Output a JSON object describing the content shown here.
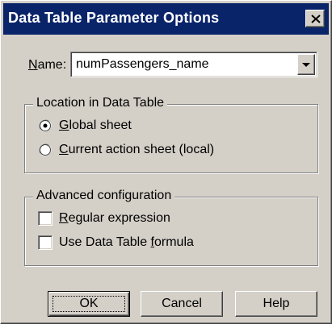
{
  "window": {
    "title": "Data Table Parameter Options"
  },
  "name_field": {
    "label_mnemonic": "N",
    "label_rest": "ame:",
    "value": "numPassengers_name"
  },
  "location_group": {
    "title": "Location in Data Table",
    "options": [
      {
        "mnemonic": "G",
        "rest": "lobal sheet",
        "selected": true
      },
      {
        "mnemonic": "C",
        "rest": "urrent action sheet (local)",
        "selected": false
      }
    ]
  },
  "advanced_group": {
    "title": "Advanced configuration",
    "options": [
      {
        "mnemonic": "R",
        "rest": "egular expression",
        "checked": false
      },
      {
        "before": "Use Data Table ",
        "mnemonic": "f",
        "rest": "ormula",
        "checked": false
      }
    ]
  },
  "buttons": {
    "ok": "OK",
    "cancel": "Cancel",
    "help": "Help"
  },
  "icons": {
    "close": "close-icon",
    "dropdown": "chevron-down-icon"
  },
  "colors": {
    "titlebar": "#0a246a",
    "face": "#d4d0c8"
  }
}
